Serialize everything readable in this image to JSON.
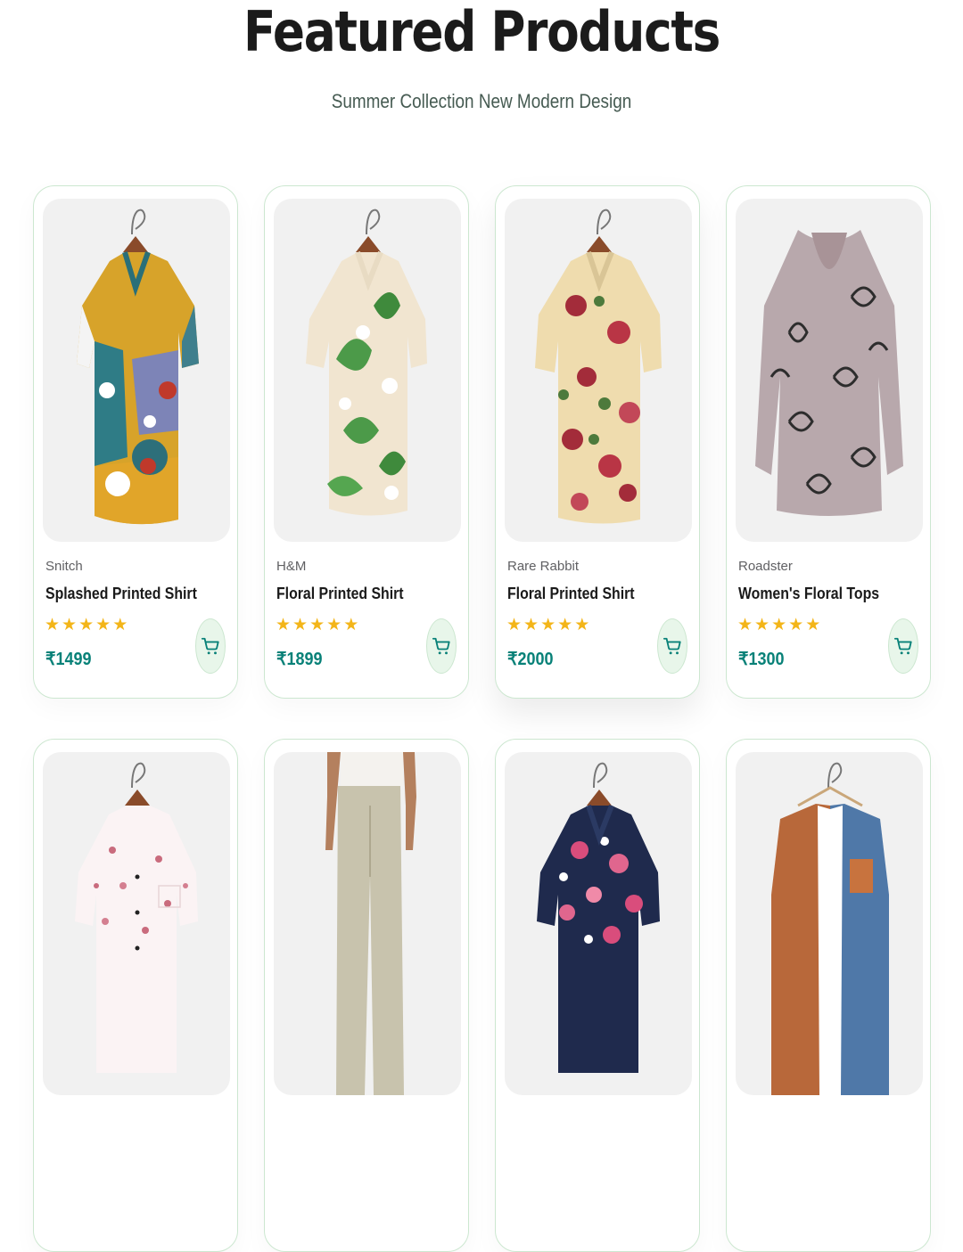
{
  "section": {
    "title": "Featured Products",
    "subtitle": "Summer Collection New Modern Design"
  },
  "colors": {
    "accent": "#088178",
    "star": "#f3b519",
    "card_border": "#cce7d0",
    "cart_bg": "#e8f6ea"
  },
  "products": [
    {
      "brand": "Snitch",
      "name": "Splashed Printed Shirt",
      "price": "₹1499",
      "rating": 5,
      "image": "splashed-printed-shirt-image"
    },
    {
      "brand": "H&M",
      "name": "Floral Printed Shirt",
      "price": "₹1899",
      "rating": 5,
      "image": "floral-lily-shirt-image"
    },
    {
      "brand": "Rare Rabbit",
      "name": "Floral Printed Shirt",
      "price": "₹2000",
      "rating": 5,
      "image": "floral-rose-shirt-image"
    },
    {
      "brand": "Roadster",
      "name": "Women's Floral Tops",
      "price": "₹1300",
      "rating": 5,
      "image": "womens-floral-top-image"
    },
    {
      "image": "pink-blossom-shirt-image"
    },
    {
      "image": "linen-trousers-image"
    },
    {
      "image": "navy-floral-shirt-image"
    },
    {
      "image": "colorblock-shirt-image"
    }
  ]
}
